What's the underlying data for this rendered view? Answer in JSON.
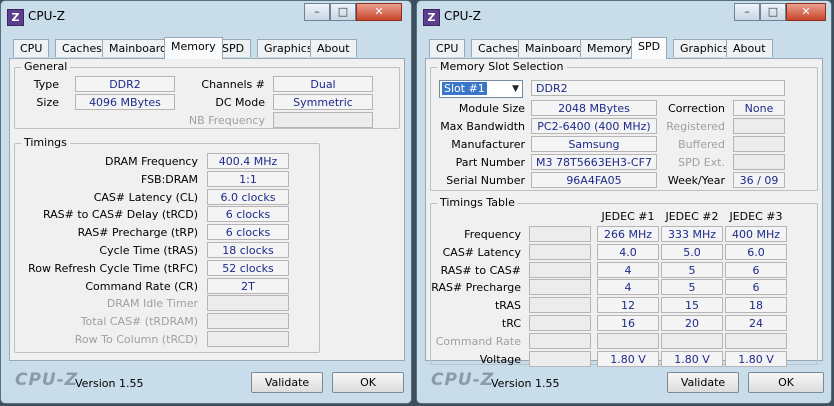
{
  "left": {
    "title": "CPU-Z",
    "icon_letter": "Z",
    "tabs": [
      "CPU",
      "Caches",
      "Mainboard",
      "Memory",
      "SPD",
      "Graphics",
      "About"
    ],
    "active_tab": "Memory",
    "general": {
      "title": "General",
      "type_label": "Type",
      "type_value": "DDR2",
      "size_label": "Size",
      "size_value": "4096 MBytes",
      "channels_label": "Channels #",
      "channels_value": "Dual",
      "dcmode_label": "DC Mode",
      "dcmode_value": "Symmetric",
      "nbfreq_label": "NB Frequency",
      "nbfreq_value": ""
    },
    "timings": {
      "title": "Timings",
      "rows": [
        {
          "label": "DRAM Frequency",
          "value": "400.4 MHz",
          "enabled": true
        },
        {
          "label": "FSB:DRAM",
          "value": "1:1",
          "enabled": true
        },
        {
          "label": "CAS# Latency (CL)",
          "value": "6.0 clocks",
          "enabled": true
        },
        {
          "label": "RAS# to CAS# Delay (tRCD)",
          "value": "6 clocks",
          "enabled": true
        },
        {
          "label": "RAS# Precharge (tRP)",
          "value": "6 clocks",
          "enabled": true
        },
        {
          "label": "Cycle Time (tRAS)",
          "value": "18 clocks",
          "enabled": true
        },
        {
          "label": "Row Refresh Cycle Time (tRFC)",
          "value": "52 clocks",
          "enabled": true
        },
        {
          "label": "Command Rate (CR)",
          "value": "2T",
          "enabled": true
        },
        {
          "label": "DRAM Idle Timer",
          "value": "",
          "enabled": false
        },
        {
          "label": "Total CAS# (tRDRAM)",
          "value": "",
          "enabled": false
        },
        {
          "label": "Row To Column (tRCD)",
          "value": "",
          "enabled": false
        }
      ]
    },
    "footer": {
      "brand": "CPU-Z",
      "version": "Version 1.55",
      "validate": "Validate",
      "ok": "OK"
    }
  },
  "right": {
    "title": "CPU-Z",
    "icon_letter": "Z",
    "tabs": [
      "CPU",
      "Caches",
      "Mainboard",
      "Memory",
      "SPD",
      "Graphics",
      "About"
    ],
    "active_tab": "SPD",
    "slot": {
      "title": "Memory Slot Selection",
      "selected": "Slot #1",
      "type_value": "DDR2",
      "module_size_label": "Module Size",
      "module_size_value": "2048 MBytes",
      "max_bw_label": "Max Bandwidth",
      "max_bw_value": "PC2-6400 (400 MHz)",
      "manufacturer_label": "Manufacturer",
      "manufacturer_value": "Samsung",
      "part_label": "Part Number",
      "part_value": "M3 78T5663EH3-CF7",
      "serial_label": "Serial Number",
      "serial_value": "96A4FA05",
      "correction_label": "Correction",
      "correction_value": "None",
      "registered_label": "Registered",
      "registered_value": "",
      "buffered_label": "Buffered",
      "buffered_value": "",
      "spdext_label": "SPD Ext.",
      "spdext_value": "",
      "weekyear_label": "Week/Year",
      "weekyear_value": "36 / 09"
    },
    "timings_table": {
      "title": "Timings Table",
      "columns": [
        "JEDEC #1",
        "JEDEC #2",
        "JEDEC #3"
      ],
      "rows": [
        {
          "label": "Frequency",
          "values": [
            "266 MHz",
            "333 MHz",
            "400 MHz"
          ],
          "enabled": true
        },
        {
          "label": "CAS# Latency",
          "values": [
            "4.0",
            "5.0",
            "6.0"
          ],
          "enabled": true
        },
        {
          "label": "RAS# to CAS#",
          "values": [
            "4",
            "5",
            "6"
          ],
          "enabled": true
        },
        {
          "label": "RAS# Precharge",
          "values": [
            "4",
            "5",
            "6"
          ],
          "enabled": true
        },
        {
          "label": "tRAS",
          "values": [
            "12",
            "15",
            "18"
          ],
          "enabled": true
        },
        {
          "label": "tRC",
          "values": [
            "16",
            "20",
            "24"
          ],
          "enabled": true
        },
        {
          "label": "Command Rate",
          "values": [
            "",
            "",
            ""
          ],
          "enabled": false
        },
        {
          "label": "Voltage",
          "values": [
            "1.80 V",
            "1.80 V",
            "1.80 V"
          ],
          "enabled": true
        }
      ]
    },
    "footer": {
      "brand": "CPU-Z",
      "version": "Version 1.55",
      "validate": "Validate",
      "ok": "OK"
    }
  }
}
